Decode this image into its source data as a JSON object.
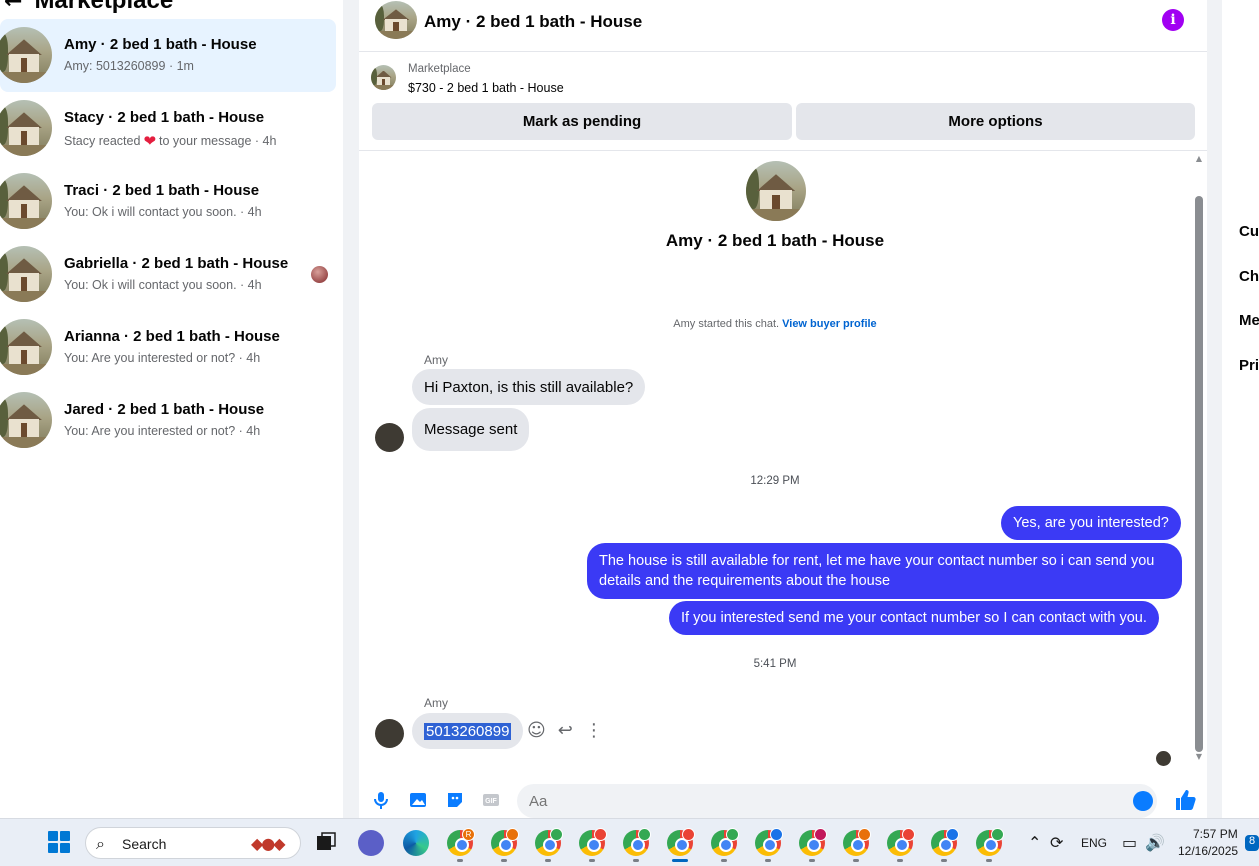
{
  "sidebar": {
    "title": "Marketplace",
    "conversations": [
      {
        "name": "Amy · 2 bed 1 bath - House",
        "snippet": "Amy: 5013260899 · 1m"
      },
      {
        "name": "Stacy · 2 bed 1 bath - House",
        "snippet_pre": "Stacy reacted",
        "snippet_post": "to your message · 4h"
      },
      {
        "name": "Traci · 2 bed 1 bath - House",
        "snippet": "You: Ok i will contact you soon. · 4h"
      },
      {
        "name": "Gabriella · 2 bed 1 bath - House",
        "snippet": "You: Ok i will contact you soon. · 4h"
      },
      {
        "name": "Arianna · 2 bed 1 bath - House",
        "snippet": "You: Are you interested or not? · 4h"
      },
      {
        "name": "Jared · 2 bed 1 bath - House",
        "snippet": "You: Are you interested or not? · 4h"
      }
    ]
  },
  "chat": {
    "title": "Amy · 2 bed 1 bath - House",
    "listing": {
      "source": "Marketplace",
      "price_title": "$730 - 2 bed 1 bath - House",
      "mark_pending_label": "Mark as pending",
      "more_options_label": "More options"
    },
    "center_title": "Amy · 2 bed 1 bath - House",
    "started_text": "Amy started this chat.",
    "view_profile_label": "View buyer profile",
    "sender_name": "Amy",
    "messages_in_1": [
      "Hi Paxton, is this still available?",
      "Message sent"
    ],
    "time_1": "12:29 PM",
    "messages_out": [
      "Yes, are you interested?",
      "The house is still available for rent, let me have your contact number so i can send you details and the requirements about the house",
      "If you interested send me your contact number so I can contact with you."
    ],
    "time_2": "5:41 PM",
    "sender_name_2": "Amy",
    "last_message": "5013260899",
    "composer_placeholder": "Aa"
  },
  "right_panel": {
    "items": [
      "Cus",
      "Cha",
      "Me",
      "Pri"
    ]
  },
  "taskbar": {
    "search_label": "Search",
    "language": "ENG",
    "time": "7:57 PM",
    "date": "12/16/2025",
    "notification_count": "8",
    "profile_badge_letter": "R"
  },
  "colors": {
    "accent_blue": "#3b3af5",
    "info_purple": "#a100f2",
    "link_blue": "#0064d1",
    "active_row": "#e7f3ff"
  }
}
